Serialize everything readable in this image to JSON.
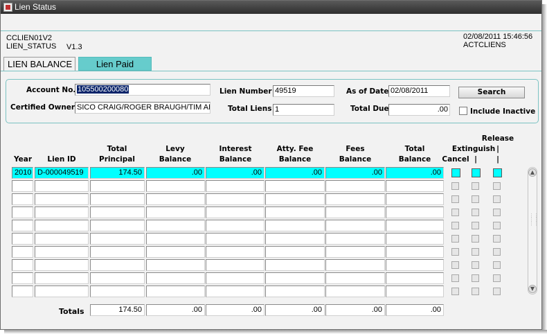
{
  "window": {
    "title": "Lien Status"
  },
  "header": {
    "form_id": "CCLIEN01V2",
    "form_name": "LIEN_STATUS",
    "version": "V1.3",
    "datetime": "02/08/2011 15:46:56",
    "user": "ACTCLIENS"
  },
  "tabs": [
    {
      "label": "LIEN BALANCE",
      "active": true
    },
    {
      "label": "Lien Paid",
      "active": false
    }
  ],
  "search": {
    "account_label": "Account No.",
    "account_value": "105500200080",
    "owner_label": "Certified Owner",
    "owner_value": "SICO CRAIG/ROGER BRAUGH/TIM AKAF",
    "lien_number_label": "Lien Number",
    "lien_number_value": "49519",
    "total_liens_label": "Total Liens",
    "total_liens_value": "1",
    "as_of_label": "As of Date",
    "as_of_value": "02/08/2011",
    "total_due_label": "Total Due",
    "total_due_value": ".00",
    "search_button": "Search",
    "include_inactive_label": "Include Inactive"
  },
  "grid": {
    "headers": {
      "year": "Year",
      "lien_id": "Lien ID",
      "total_principal_1": "Total",
      "total_principal_2": "Principal",
      "levy_1": "Levy",
      "levy_2": "Balance",
      "interest_1": "Interest",
      "interest_2": "Balance",
      "atty_1": "Atty. Fee",
      "atty_2": "Balance",
      "fees_1": "Fees",
      "fees_2": "Balance",
      "total_bal_1": "Total",
      "total_bal_2": "Balance",
      "release": "Release",
      "extinguish": "Extinguish",
      "cancel": "Cancel",
      "sep": "|"
    },
    "rows": [
      {
        "year": "2010",
        "lien_id": "D-000049519",
        "total_principal": "174.50",
        "levy": ".00",
        "interest": ".00",
        "atty": ".00",
        "fees": ".00",
        "total_balance": ".00"
      },
      {
        "year": "",
        "lien_id": "",
        "total_principal": "",
        "levy": "",
        "interest": "",
        "atty": "",
        "fees": "",
        "total_balance": ""
      },
      {
        "year": "",
        "lien_id": "",
        "total_principal": "",
        "levy": "",
        "interest": "",
        "atty": "",
        "fees": "",
        "total_balance": ""
      },
      {
        "year": "",
        "lien_id": "",
        "total_principal": "",
        "levy": "",
        "interest": "",
        "atty": "",
        "fees": "",
        "total_balance": ""
      },
      {
        "year": "",
        "lien_id": "",
        "total_principal": "",
        "levy": "",
        "interest": "",
        "atty": "",
        "fees": "",
        "total_balance": ""
      },
      {
        "year": "",
        "lien_id": "",
        "total_principal": "",
        "levy": "",
        "interest": "",
        "atty": "",
        "fees": "",
        "total_balance": ""
      },
      {
        "year": "",
        "lien_id": "",
        "total_principal": "",
        "levy": "",
        "interest": "",
        "atty": "",
        "fees": "",
        "total_balance": ""
      },
      {
        "year": "",
        "lien_id": "",
        "total_principal": "",
        "levy": "",
        "interest": "",
        "atty": "",
        "fees": "",
        "total_balance": ""
      },
      {
        "year": "",
        "lien_id": "",
        "total_principal": "",
        "levy": "",
        "interest": "",
        "atty": "",
        "fees": "",
        "total_balance": ""
      },
      {
        "year": "",
        "lien_id": "",
        "total_principal": "",
        "levy": "",
        "interest": "",
        "atty": "",
        "fees": "",
        "total_balance": ""
      }
    ]
  },
  "totals": {
    "label": "Totals",
    "total_principal": "174.50",
    "levy": ".00",
    "interest": ".00",
    "atty": ".00",
    "fees": ".00",
    "total_balance": ".00"
  },
  "colors": {
    "current_row": "#00ffff",
    "tab_inactive": "#66cccc",
    "panel_border": "#7ac2c2",
    "selection": "#0a246a"
  }
}
